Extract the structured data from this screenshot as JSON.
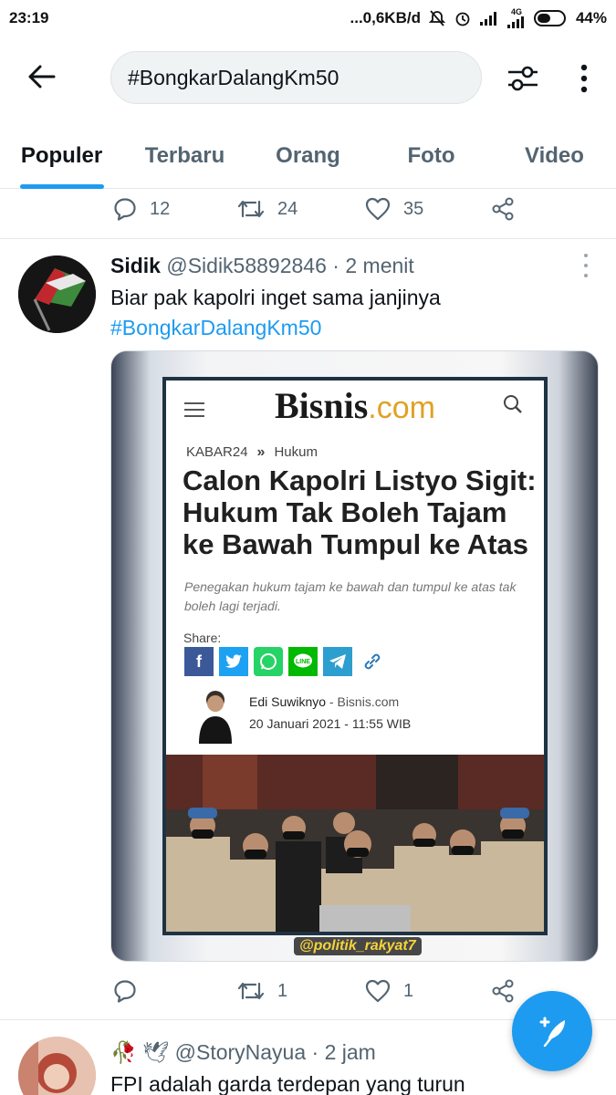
{
  "status_bar": {
    "time": "23:19",
    "network_speed": "...0,6KB/d",
    "network_type": "4G",
    "battery": "44%"
  },
  "search": {
    "query": "#BongkarDalangKm50"
  },
  "tabs": [
    {
      "label": "Populer",
      "active": true
    },
    {
      "label": "Terbaru",
      "active": false
    },
    {
      "label": "Orang",
      "active": false
    },
    {
      "label": "Foto",
      "active": false
    },
    {
      "label": "Video",
      "active": false
    }
  ],
  "prev_tweet_actions": {
    "replies": "12",
    "retweets": "24",
    "likes": "35"
  },
  "tweet": {
    "name": "Sidik",
    "handle": "@Sidik58892846",
    "time": "2 menit",
    "text": "Biar pak kapolri inget sama janjinya",
    "hashtag": "#BongkarDalangKm50",
    "actions": {
      "replies": "",
      "retweets": "1",
      "likes": "1"
    },
    "media": {
      "site_name": "Bisnis",
      "site_suffix": ".com",
      "breadcrumb_section": "KABAR24",
      "breadcrumb_separator": "»",
      "breadcrumb_category": "Hukum",
      "headline": "Calon Kapolri Listyo Sigit: Hukum Tak Boleh Tajam ke Bawah Tumpul ke Atas",
      "lede": "Penegakan hukum tajam ke bawah dan tumpul ke atas tak boleh lagi terjadi.",
      "share_label": "Share:",
      "author": "Edi Suwiknyo",
      "author_site": " - Bisnis.com",
      "date": "20 Januari 2021 - 11:55 WIB",
      "watermark": "@politik_rakyat7",
      "share_icons": [
        "facebook-icon",
        "twitter-icon",
        "whatsapp-icon",
        "line-icon",
        "telegram-icon",
        "link-icon"
      ]
    }
  },
  "next_tweet": {
    "handle": "@StoryNayua",
    "time": "2 jam",
    "text": "FPI adalah garda terdepan yang turun"
  },
  "colors": {
    "accent": "#1d9bf0",
    "text_primary": "#0f1419",
    "text_secondary": "#536471"
  }
}
